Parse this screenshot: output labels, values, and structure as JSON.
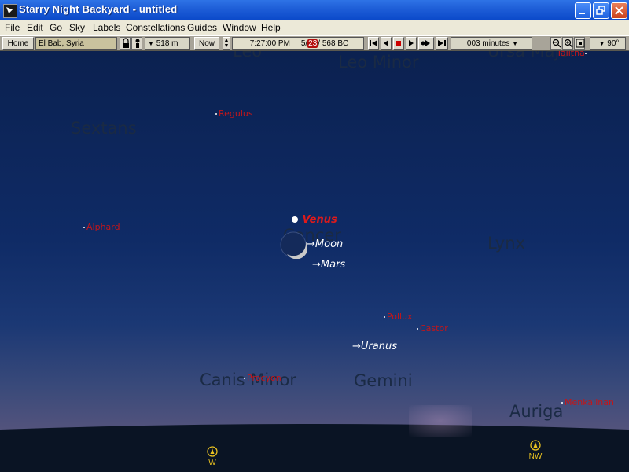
{
  "window": {
    "title": "Starry Night Backyard - untitled"
  },
  "menu": [
    "File",
    "Edit",
    "Go",
    "Sky",
    "Labels",
    "Constellations",
    "Guides",
    "Window",
    "Help"
  ],
  "toolbar": {
    "home_label": "Home",
    "location": "El Bab, Syria",
    "elevation": "518 m",
    "now_label": "Now",
    "time": "7:27:00 PM",
    "date_month": "5/",
    "date_day": "23",
    "date_rest": "/  568 BC",
    "step": "003 minutes",
    "fov": "90°"
  },
  "constellations": [
    {
      "name": "Leo Minor",
      "id": "leo-minor"
    },
    {
      "name": "Sextans",
      "id": "sextans"
    },
    {
      "name": "Cancer",
      "id": "cancer"
    },
    {
      "name": "Lynx",
      "id": "lynx"
    },
    {
      "name": "Canis Minor",
      "id": "canis-minor"
    },
    {
      "name": "Gemini",
      "id": "gemini"
    },
    {
      "name": "Auriga",
      "id": "auriga"
    },
    {
      "name": "Leo",
      "id": "leo"
    },
    {
      "name": "Ursa Major",
      "id": "ursa-major"
    }
  ],
  "stars": [
    {
      "name": "Regulus"
    },
    {
      "name": "Alphard"
    },
    {
      "name": "Pollux"
    },
    {
      "name": "Castor"
    },
    {
      "name": "Procyon"
    },
    {
      "name": "Menkalinan"
    },
    {
      "name": "Alphard",
      "note": ""
    },
    {
      "name": "Talitha"
    }
  ],
  "planets": [
    {
      "name": "Venus",
      "highlight": true
    },
    {
      "name": "Moon"
    },
    {
      "name": "Mars"
    },
    {
      "name": "Uranus"
    }
  ],
  "compass": [
    {
      "label": "W"
    },
    {
      "label": "NW"
    }
  ],
  "colors": {
    "title_bar": "#0a48c9",
    "sky_top": "#0b2150",
    "horizon": "#6b5f80",
    "star_label": "#c2161a",
    "compass": "#e8c020"
  }
}
